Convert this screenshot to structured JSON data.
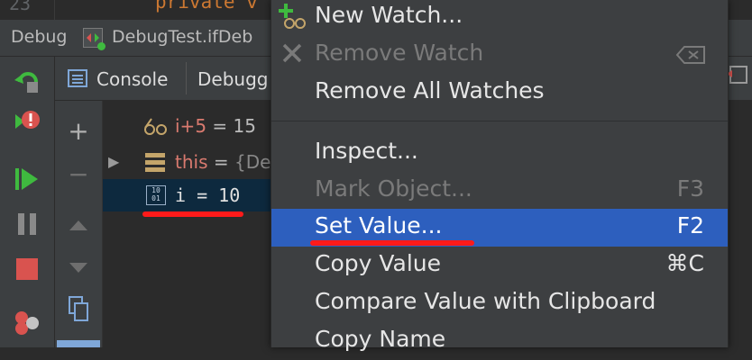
{
  "editor": {
    "line_number": "23",
    "code": "private v"
  },
  "debug_bar": {
    "title": "Debug",
    "config": "DebugTest.ifDeb"
  },
  "tabs": {
    "console": "Console",
    "debugger": "Debugg"
  },
  "watch_toolbar": {
    "add": "+",
    "remove": "−"
  },
  "variables": [
    {
      "name": "i+5",
      "operator": " = ",
      "value": "15"
    },
    {
      "name": "this",
      "operator": " = ",
      "value": "{De"
    },
    {
      "name": "i",
      "operator": " = ",
      "value": "10"
    }
  ],
  "context_menu": {
    "items": [
      {
        "label": "New Watch...",
        "shortcut": ""
      },
      {
        "label": "Remove Watch",
        "shortcut": ""
      },
      {
        "label": "Remove All Watches",
        "shortcut": ""
      },
      {
        "label": "Inspect...",
        "shortcut": ""
      },
      {
        "label": "Mark Object...",
        "shortcut": "F3"
      },
      {
        "label": "Set Value...",
        "shortcut": "F2"
      },
      {
        "label": "Copy Value",
        "shortcut": "⌘C"
      },
      {
        "label": "Compare Value with Clipboard",
        "shortcut": ""
      },
      {
        "label": "Copy Name",
        "shortcut": ""
      }
    ]
  },
  "colors": {
    "selection": "#2d5fbe",
    "highlight_underline": "#ff1a1a",
    "keyword": "#d97a6f",
    "run_green": "#3fba3f"
  }
}
